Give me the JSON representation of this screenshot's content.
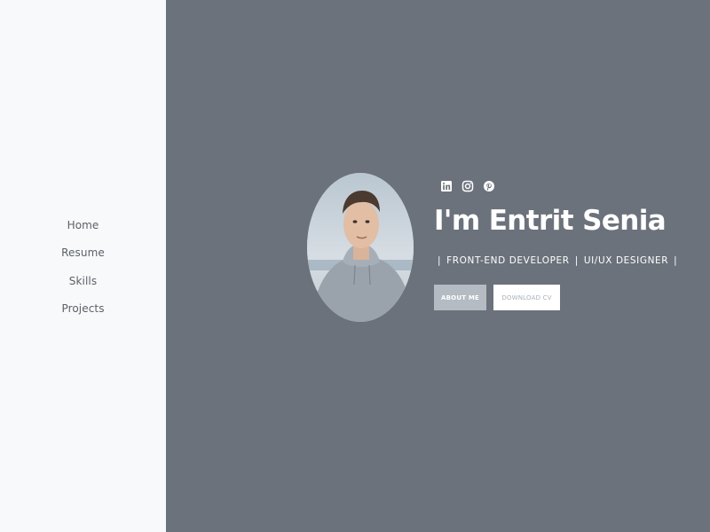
{
  "sidebar": {
    "items": [
      {
        "label": "Home"
      },
      {
        "label": "Resume"
      },
      {
        "label": "Skills"
      },
      {
        "label": "Projects"
      }
    ]
  },
  "hero": {
    "name": "I'm Entrit Senia",
    "roles": [
      "FRONT-END DEVELOPER",
      "UI/UX DESIGNER"
    ],
    "separator": "|",
    "socials": [
      {
        "icon": "linkedin-icon"
      },
      {
        "icon": "instagram-icon"
      },
      {
        "icon": "pinterest-icon"
      }
    ],
    "buttons": {
      "about_label": "ABOUT ME",
      "download_label": "DOWNLOAD CV"
    }
  },
  "colors": {
    "sidebar_bg": "#f8f9fa",
    "main_bg": "#6b727b",
    "nav_text": "#5a6169",
    "about_btn_bg": "#b4bbc3",
    "download_btn_bg": "#ffffff"
  }
}
